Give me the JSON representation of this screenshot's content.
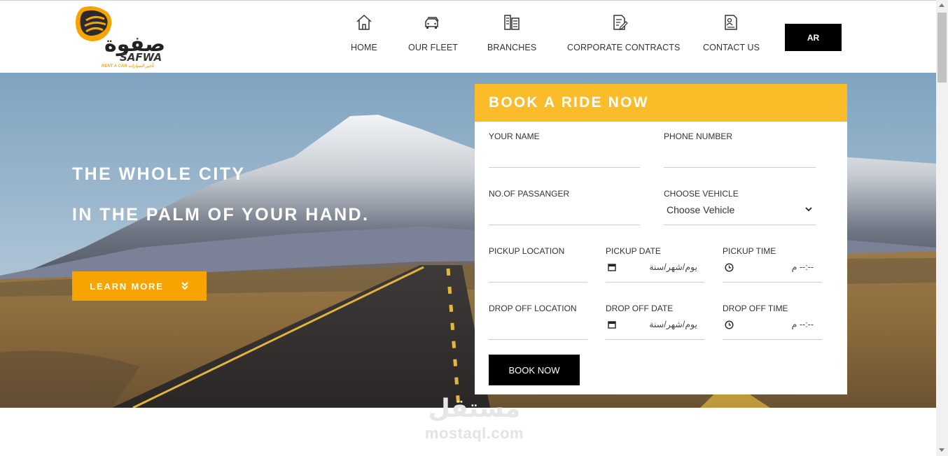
{
  "brand": {
    "name_ar": "صفوة",
    "name_en": "SAFWA",
    "tagline": "RENT A CAR تأجير السيارات",
    "colors": {
      "accent": "#f7a300",
      "form_header": "#fbbc2a",
      "dark": "#000000"
    }
  },
  "nav": {
    "items": [
      {
        "label": "HOME",
        "icon": "home-icon"
      },
      {
        "label": "OUR FLEET",
        "icon": "car-fleet-icon"
      },
      {
        "label": "BRANCHES",
        "icon": "building-icon"
      },
      {
        "label": "CORPORATE CONTRACTS",
        "icon": "contract-icon"
      },
      {
        "label": "CONTACT US",
        "icon": "contact-card-icon"
      }
    ],
    "lang_button": "AR"
  },
  "hero": {
    "line1": "THE WHOLE CITY",
    "line2": "IN THE PALM OF YOUR HAND.",
    "cta": "LEARN MORE",
    "cta_icon": "double-chevron-down-icon"
  },
  "booking": {
    "title": "BOOK A RIDE NOW",
    "name_label": "YOUR NAME",
    "phone_label": "PHONE NUMBER",
    "passengers_label": "NO.OF PASSANGER",
    "vehicle_label": "CHOOSE VEHICLE",
    "vehicle_value": "Choose Vehicle",
    "pickup_location_label": "PICKUP LOCATION",
    "pickup_date_label": "PICKUP DATE",
    "pickup_date_value": "يوم/شهر/سنة",
    "pickup_time_label": "PICKUP TIME",
    "pickup_time_value": "--:-- م",
    "dropoff_location_label": "DROP OFF LOCATION",
    "dropoff_date_label": "DROP OFF DATE",
    "dropoff_date_value": "يوم/شهر/سنة",
    "dropoff_time_label": "DROP OFF TIME",
    "dropoff_time_value": "--:-- م",
    "submit": "BOOK NOW"
  },
  "watermark": {
    "ar": "مستقل",
    "en": "mostaql.com"
  }
}
